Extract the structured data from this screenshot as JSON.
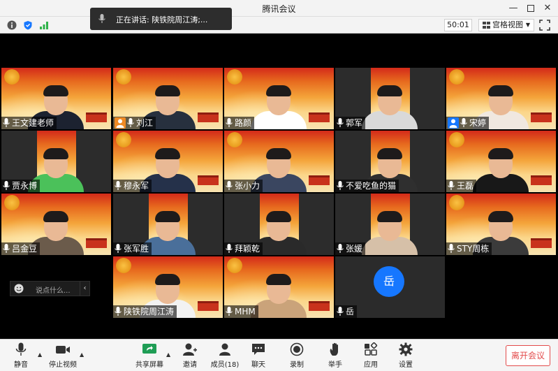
{
  "window": {
    "title": "腾讯会议"
  },
  "infobar": {
    "timer": "50:01",
    "view_label": "宫格视图"
  },
  "toast": {
    "text": "正在讲话: 陕铁院周江涛;..."
  },
  "participants": [
    {
      "name": "王文建老师",
      "shirt": "#1c2230",
      "portrait": false,
      "host": false
    },
    {
      "name": "刘江",
      "shirt": "#27303e",
      "portrait": false,
      "host": true
    },
    {
      "name": "路颜",
      "shirt": "#ffffff",
      "portrait": false,
      "host": false
    },
    {
      "name": "郭军",
      "shirt": "#d9d9d9",
      "portrait": true,
      "host": false
    },
    {
      "name": "宋婷",
      "shirt": "#f0e8e0",
      "portrait": false,
      "host": true
    },
    {
      "name": "贾永博",
      "shirt": "#4bc15a",
      "portrait": true,
      "host": false
    },
    {
      "name": "穆永军",
      "shirt": "#25314a",
      "portrait": false,
      "host": false
    },
    {
      "name": "张小力",
      "shirt": "#3a4660",
      "portrait": false,
      "host": false
    },
    {
      "name": "不爱吃鱼的猫",
      "shirt": "#2f2f2f",
      "portrait": true,
      "host": false
    },
    {
      "name": "王磊",
      "shirt": "#181818",
      "portrait": false,
      "host": false
    },
    {
      "name": "吕金豆",
      "shirt": "#6b5b4b",
      "portrait": false,
      "host": false
    },
    {
      "name": "张军胜",
      "shirt": "#4a6f9a",
      "portrait": true,
      "host": false
    },
    {
      "name": "拜颖乾",
      "shirt": "#2a2a2a",
      "portrait": true,
      "host": false
    },
    {
      "name": "张媛",
      "shirt": "#d6c0a8",
      "portrait": true,
      "host": false
    },
    {
      "name": "STY周栋",
      "shirt": "#3b3b3b",
      "portrait": false,
      "host": false
    },
    {
      "name": "陕铁院周江涛",
      "shirt": "#f2f2f2",
      "portrait": false,
      "host": false
    },
    {
      "name": "MHM",
      "shirt": "#caa37a",
      "portrait": false,
      "host": false
    },
    {
      "name": "岳",
      "shirt": "",
      "portrait": false,
      "host": false,
      "avatar": "岳"
    }
  ],
  "chat": {
    "placeholder": "说点什么..."
  },
  "toolbar": {
    "mute": "静音",
    "stop_video": "停止视频",
    "share": "共享屏幕",
    "invite": "邀请",
    "members": "成员(18)",
    "chat": "聊天",
    "record": "录制",
    "raise_hand": "举手",
    "apps": "应用",
    "settings": "设置",
    "leave": "离开会议"
  },
  "colors": {
    "accent_blue": "#1677ff",
    "leave_red": "#e34b4b",
    "host_orange": "#f08a24",
    "host_blue": "#1677ff"
  }
}
